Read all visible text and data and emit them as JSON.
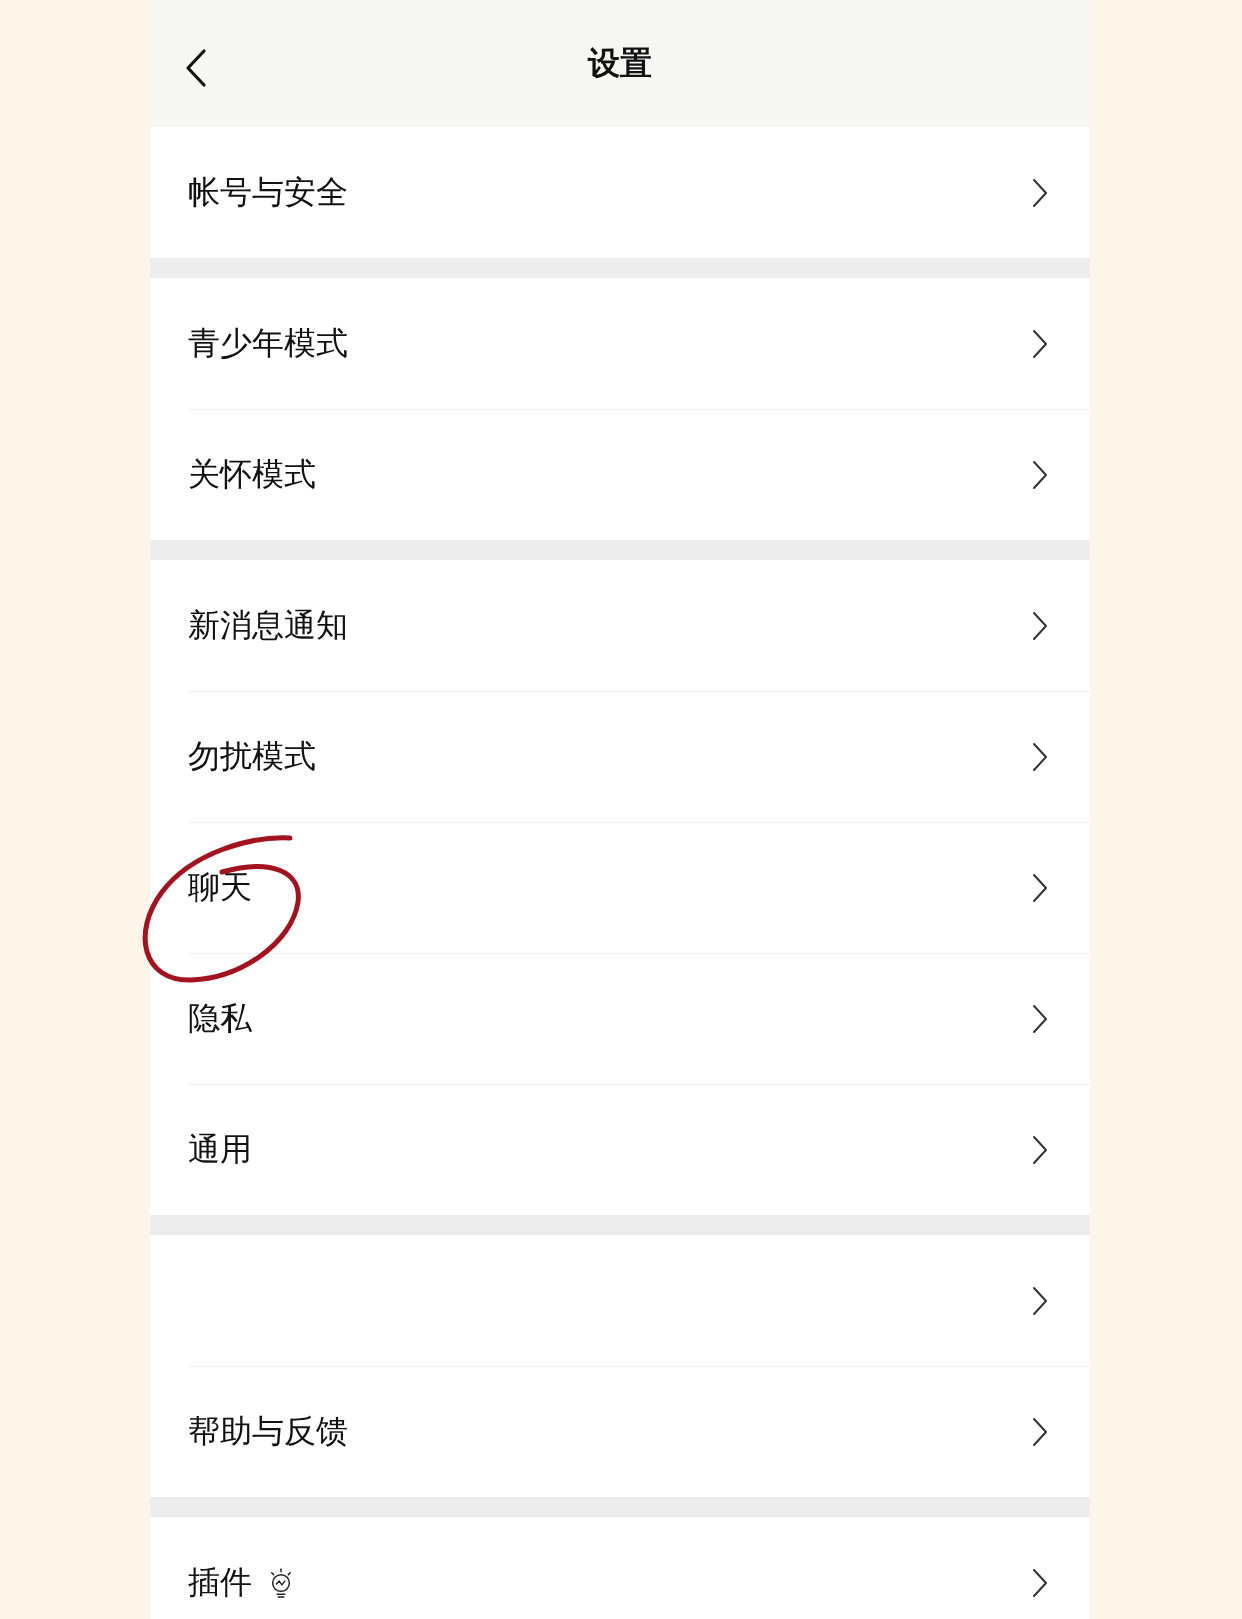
{
  "header": {
    "title": "设置"
  },
  "sections": [
    {
      "items": [
        {
          "label": "帐号与安全",
          "circled": false
        }
      ]
    },
    {
      "items": [
        {
          "label": "青少年模式",
          "circled": false
        },
        {
          "label": "关怀模式",
          "circled": false
        }
      ]
    },
    {
      "items": [
        {
          "label": "新消息通知",
          "circled": false
        },
        {
          "label": "勿扰模式",
          "circled": false
        },
        {
          "label": "聊天",
          "circled": true
        },
        {
          "label": "隐私",
          "circled": false
        },
        {
          "label": "通用",
          "circled": false
        }
      ]
    },
    {
      "items": [
        {
          "circled": false
        },
        {
          "label": "帮助与反馈",
          "circled": false
        }
      ]
    },
    {
      "items": [
        {
          "label": "插件",
          "circled": false,
          "kind": "plugin"
        }
      ]
    }
  ]
}
